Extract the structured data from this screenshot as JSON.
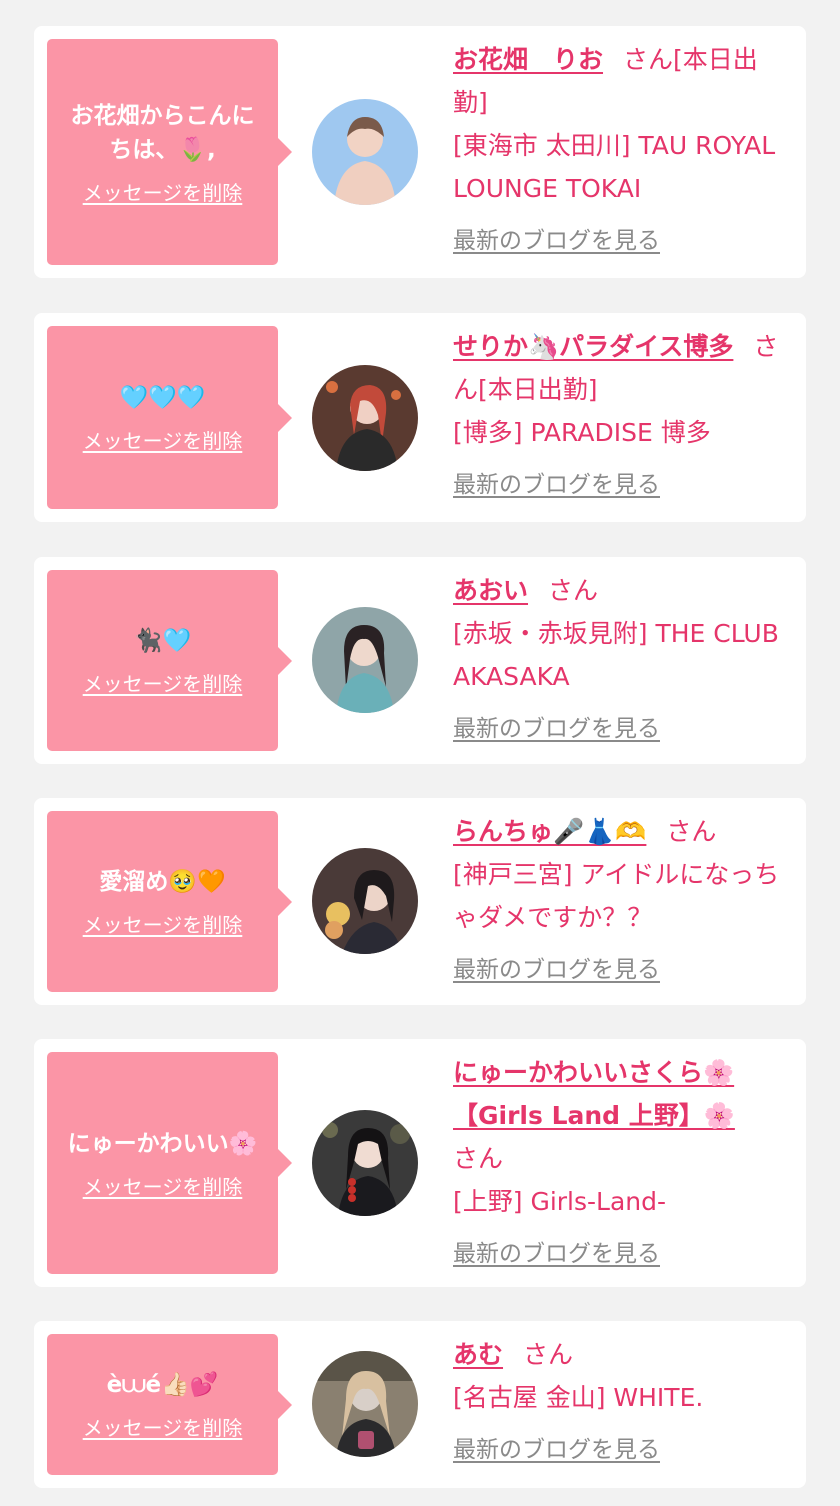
{
  "colors": {
    "page_bg": "#f2f2f2",
    "card_bg": "#ffffff",
    "bubble_bg": "#fb95a6",
    "accent_pink": "#e5356a",
    "link_gray": "#8a8a8a"
  },
  "common": {
    "delete_label": "メッセージを削除",
    "blog_label": "最新のブログを見る"
  },
  "items": [
    {
      "message": "お花畑からこんにちは、🌷,",
      "name": "お花畑　りお",
      "honorific": "さん",
      "status": "[本日出勤]",
      "shop": "[東海市 太田川] TAU ROYAL LOUNGE TOKAI",
      "avatar_icon": "profile-photo-icon",
      "avatar_color": "#9fc8f0"
    },
    {
      "message": "🩵🩵🩵",
      "name": "せりか🦄パラダイス博多",
      "honorific": "さん",
      "status": "[本日出勤]",
      "shop": "[博多] PARADISE 博多",
      "avatar_icon": "profile-photo-icon",
      "avatar_color": "#5a3a30"
    },
    {
      "message": "🐈‍⬛🩵",
      "name": "あおい",
      "honorific": "さん",
      "status": "",
      "shop": "[赤坂・赤坂見附] THE CLUB AKASAKA",
      "avatar_icon": "profile-photo-icon",
      "avatar_color": "#8fa5a8"
    },
    {
      "message": "愛溜め🥹🧡",
      "name": "らんちゅ🎤👗🫶",
      "honorific": "さん",
      "status": "",
      "shop": "[神戸三宮] アイドルになっちゃダメですか？？",
      "avatar_icon": "profile-photo-icon",
      "avatar_color": "#4a3a38"
    },
    {
      "message": "にゅーかわいい🌸",
      "name": "にゅーかわいいさくら🌸【Girls Land 上野】🌸",
      "honorific": "さん",
      "status": "",
      "shop": "[上野] Girls-Land-",
      "avatar_icon": "profile-photo-icon",
      "avatar_color": "#3a3a3a"
    },
    {
      "message": "è⩊é👍🏻💕",
      "name": "あむ",
      "honorific": "さん",
      "status": "",
      "shop": "[名古屋 金山] WHITE.",
      "avatar_icon": "profile-photo-icon",
      "avatar_color": "#8a8070"
    }
  ]
}
